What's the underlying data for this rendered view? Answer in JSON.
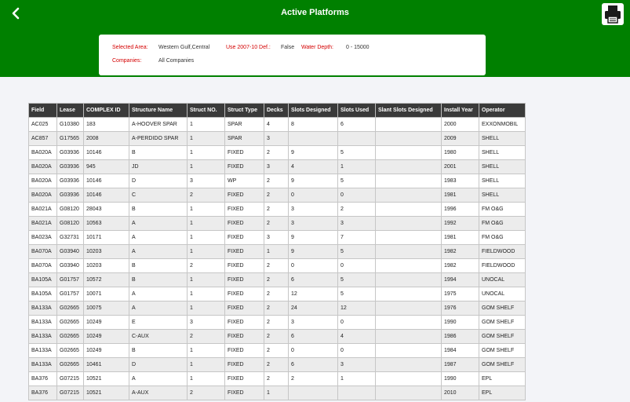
{
  "header": {
    "title": "Active Platforms"
  },
  "filters": {
    "selected_area_label": "Selected Area:",
    "selected_area_value": "Western Gulf,Central",
    "use_def_label": "Use 2007-10 Def.:",
    "use_def_value": "False",
    "water_depth_label": "Water Depth:",
    "water_depth_value": "0 - 15000",
    "companies_label": "Companies:",
    "companies_value": "All Companies"
  },
  "table": {
    "columns": [
      "Field",
      "Lease",
      "COMPLEX ID",
      "Structure Name",
      "Struct NO.",
      "Struct Type",
      "Decks",
      "Slots Designed",
      "Slots Used",
      "Slant Slots Designed",
      "Install Year",
      "Operator"
    ],
    "rows": [
      [
        "AC025",
        "G10380",
        "183",
        "A-HOOVER SPAR",
        "1",
        "SPAR",
        "4",
        "8",
        "6",
        "",
        "2000",
        "EXXONMOBIL"
      ],
      [
        "AC857",
        "G17565",
        "2008",
        "A-PERDIDO SPAR",
        "1",
        "SPAR",
        "3",
        "",
        "",
        "",
        "2009",
        "SHELL"
      ],
      [
        "BA020A",
        "G03936",
        "10146",
        "B",
        "1",
        "FIXED",
        "2",
        "9",
        "5",
        "",
        "1980",
        "SHELL"
      ],
      [
        "BA020A",
        "G03936",
        "945",
        "JD",
        "1",
        "FIXED",
        "3",
        "4",
        "1",
        "",
        "2001",
        "SHELL"
      ],
      [
        "BA020A",
        "G03936",
        "10146",
        "D",
        "3",
        "WP",
        "2",
        "9",
        "5",
        "",
        "1983",
        "SHELL"
      ],
      [
        "BA020A",
        "G03936",
        "10146",
        "C",
        "2",
        "FIXED",
        "2",
        "0",
        "0",
        "",
        "1981",
        "SHELL"
      ],
      [
        "BA021A",
        "G08120",
        "28043",
        "B",
        "1",
        "FIXED",
        "2",
        "3",
        "2",
        "",
        "1996",
        "FM O&G"
      ],
      [
        "BA021A",
        "G08120",
        "10563",
        "A",
        "1",
        "FIXED",
        "2",
        "3",
        "3",
        "",
        "1992",
        "FM O&G"
      ],
      [
        "BA023A",
        "G32731",
        "10171",
        "A",
        "1",
        "FIXED",
        "3",
        "9",
        "7",
        "",
        "1981",
        "FM O&G"
      ],
      [
        "BA070A",
        "G03940",
        "10203",
        "A",
        "1",
        "FIXED",
        "1",
        "9",
        "5",
        "",
        "1982",
        "FIELDWOOD"
      ],
      [
        "BA070A",
        "G03940",
        "10203",
        "B",
        "2",
        "FIXED",
        "2",
        "0",
        "0",
        "",
        "1982",
        "FIELDWOOD"
      ],
      [
        "BA105A",
        "G01757",
        "10572",
        "B",
        "1",
        "FIXED",
        "2",
        "6",
        "5",
        "",
        "1994",
        "UNOCAL"
      ],
      [
        "BA105A",
        "G01757",
        "10071",
        "A",
        "1",
        "FIXED",
        "2",
        "12",
        "5",
        "",
        "1975",
        "UNOCAL"
      ],
      [
        "BA133A",
        "G02665",
        "10075",
        "A",
        "1",
        "FIXED",
        "2",
        "24",
        "12",
        "",
        "1976",
        "GOM SHELF"
      ],
      [
        "BA133A",
        "G02665",
        "10249",
        "E",
        "3",
        "FIXED",
        "2",
        "3",
        "0",
        "",
        "1990",
        "GOM SHELF"
      ],
      [
        "BA133A",
        "G02665",
        "10249",
        "C-AUX",
        "2",
        "FIXED",
        "2",
        "6",
        "4",
        "",
        "1986",
        "GOM SHELF"
      ],
      [
        "BA133A",
        "G02665",
        "10249",
        "B",
        "1",
        "FIXED",
        "2",
        "0",
        "0",
        "",
        "1984",
        "GOM SHELF"
      ],
      [
        "BA133A",
        "G02665",
        "10461",
        "D",
        "1",
        "FIXED",
        "2",
        "6",
        "3",
        "",
        "1987",
        "GOM SHELF"
      ],
      [
        "BA376",
        "G07215",
        "10521",
        "A",
        "1",
        "FIXED",
        "2",
        "2",
        "1",
        "",
        "1990",
        "EPL"
      ],
      [
        "BA376",
        "G07215",
        "10521",
        "A-AUX",
        "2",
        "FIXED",
        "1",
        "",
        "",
        "",
        "2010",
        "EPL"
      ]
    ]
  }
}
